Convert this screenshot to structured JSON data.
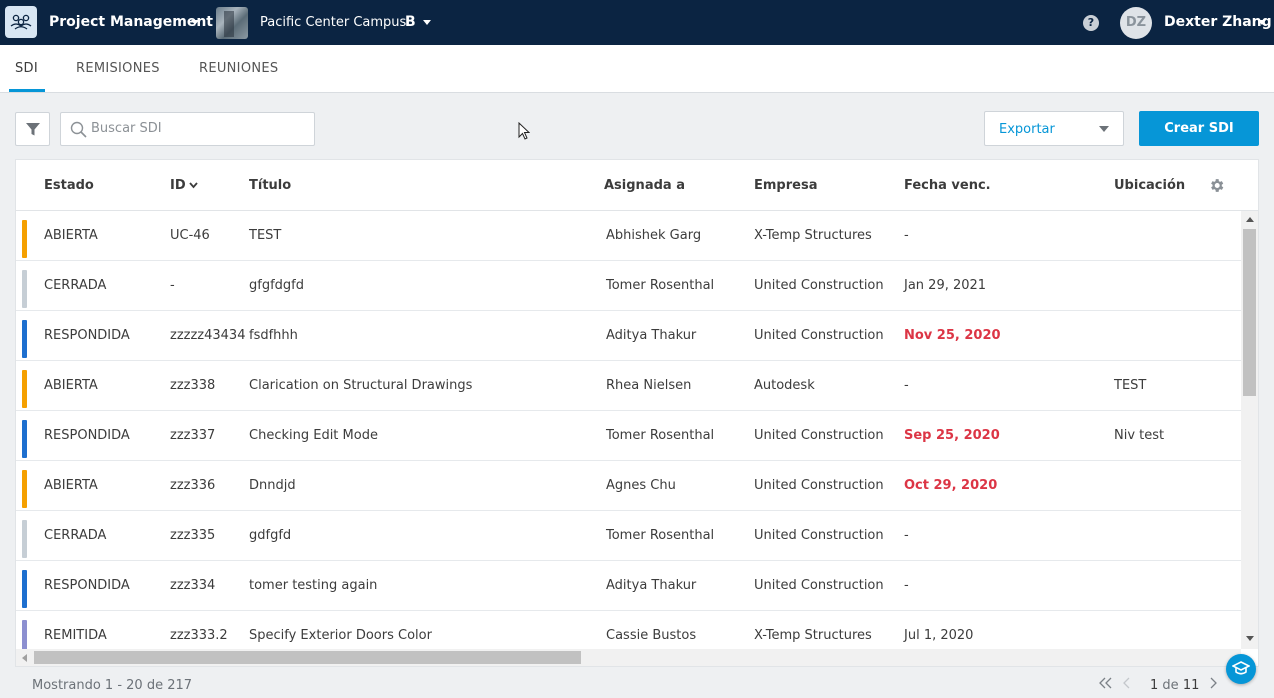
{
  "header": {
    "app_title": "Project Management",
    "project_name": "Pacific Center Campus",
    "project_badge": "B",
    "help_label": "?",
    "user_initials": "DZ",
    "user_name": "Dexter Zhang"
  },
  "tabs": [
    {
      "label": "SDI",
      "active": true
    },
    {
      "label": "REMISIONES",
      "active": false
    },
    {
      "label": "REUNIONES",
      "active": false
    }
  ],
  "toolbar": {
    "search_placeholder": "Buscar SDI",
    "search_value": "",
    "export_label": "Exportar",
    "create_label": "Crear SDI"
  },
  "table": {
    "columns": {
      "status": "Estado",
      "id": "ID",
      "title": "Título",
      "assigned": "Asignada a",
      "company": "Empresa",
      "due": "Fecha venc.",
      "location": "Ubicación"
    },
    "sort_column": "ID",
    "rows": [
      {
        "status": "ABIERTA",
        "color": "#f5a000",
        "id": "UC-46",
        "title": "TEST",
        "assigned": "Abhishek Garg",
        "company": "X-Temp Structures",
        "due": "-",
        "overdue": false,
        "location": ""
      },
      {
        "status": "CERRADA",
        "color": "#c6ced5",
        "id": "-",
        "title": "gfgfdgfd",
        "assigned": "Tomer Rosenthal",
        "company": "United Construction",
        "due": "Jan 29, 2021",
        "overdue": false,
        "location": ""
      },
      {
        "status": "RESPONDIDA",
        "color": "#1d6fcf",
        "id": "zzzzz43434",
        "title": "fsdfhhh",
        "assigned": "Aditya Thakur",
        "company": "United Construction",
        "due": "Nov 25, 2020",
        "overdue": true,
        "location": ""
      },
      {
        "status": "ABIERTA",
        "color": "#f5a000",
        "id": "zzz338",
        "title": "Clarication on Structural Drawings",
        "assigned": "Rhea Nielsen",
        "company": "Autodesk",
        "due": "-",
        "overdue": false,
        "location": "TEST"
      },
      {
        "status": "RESPONDIDA",
        "color": "#1d6fcf",
        "id": "zzz337",
        "title": "Checking Edit Mode",
        "assigned": "Tomer Rosenthal",
        "company": "United Construction",
        "due": "Sep 25, 2020",
        "overdue": true,
        "location": "Niv test"
      },
      {
        "status": "ABIERTA",
        "color": "#f5a000",
        "id": "zzz336",
        "title": "Dnndjd",
        "assigned": "Agnes Chu",
        "company": "United Construction",
        "due": "Oct 29, 2020",
        "overdue": true,
        "location": ""
      },
      {
        "status": "CERRADA",
        "color": "#c6ced5",
        "id": "zzz335",
        "title": "gdfgfd",
        "assigned": "Tomer Rosenthal",
        "company": "United Construction",
        "due": "-",
        "overdue": false,
        "location": ""
      },
      {
        "status": "RESPONDIDA",
        "color": "#1d6fcf",
        "id": "zzz334",
        "title": "tomer testing again",
        "assigned": "Aditya Thakur",
        "company": "United Construction",
        "due": "-",
        "overdue": false,
        "location": ""
      },
      {
        "status": "REMITIDA",
        "color": "#8c8fd0",
        "id": "zzz333.2",
        "title": "Specify Exterior Doors Color",
        "assigned": "Cassie Bustos",
        "company": "X-Temp Structures",
        "due": "Jul 1, 2020",
        "overdue": false,
        "location": ""
      }
    ]
  },
  "footer": {
    "showing": "Mostrando 1 - 20 de 217",
    "page_current": "1",
    "page_of": "de",
    "page_total": "11"
  },
  "colors": {
    "topbar": "#0b2442",
    "accent": "#0696d7",
    "overdue": "#dc3545"
  }
}
